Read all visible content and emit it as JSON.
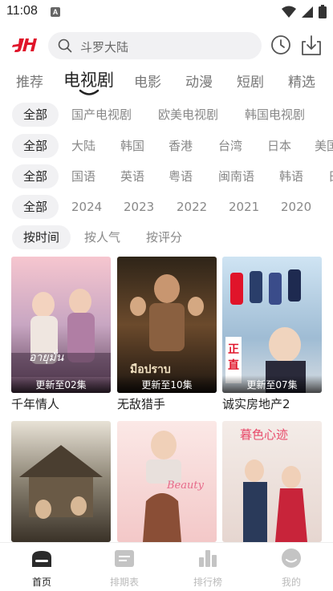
{
  "status": {
    "time": "11:08",
    "notif": "A"
  },
  "search": {
    "placeholder": "斗罗大陆"
  },
  "category_tabs": [
    {
      "label": "推荐"
    },
    {
      "label": "电视剧"
    },
    {
      "label": "电影"
    },
    {
      "label": "动漫"
    },
    {
      "label": "短剧"
    },
    {
      "label": "精选"
    }
  ],
  "filters": {
    "genre": [
      "全部",
      "国产电视剧",
      "欧美电视剧",
      "韩国电视剧"
    ],
    "region": [
      "全部",
      "大陆",
      "韩国",
      "香港",
      "台湾",
      "日本",
      "美国"
    ],
    "language": [
      "全部",
      "国语",
      "英语",
      "粤语",
      "闽南语",
      "韩语",
      "日"
    ],
    "year": [
      "全部",
      "2024",
      "2023",
      "2022",
      "2021",
      "2020"
    ],
    "sort": [
      "按时间",
      "按人气",
      "按评分"
    ]
  },
  "shows": [
    {
      "title": "千年情人",
      "badge": "更新至02集"
    },
    {
      "title": "无敌猎手",
      "badge": "更新至10集"
    },
    {
      "title": "诚实房地产2",
      "badge": "更新至07集"
    },
    {
      "title": "",
      "badge": ""
    },
    {
      "title": "",
      "badge": ""
    },
    {
      "title": "",
      "badge": ""
    }
  ],
  "nav": [
    {
      "label": "首页",
      "icon": "home-icon"
    },
    {
      "label": "排期表",
      "icon": "schedule-icon"
    },
    {
      "label": "排行榜",
      "icon": "ranking-icon"
    },
    {
      "label": "我的",
      "icon": "profile-icon"
    }
  ],
  "colors": {
    "accent": "#e0142a",
    "text": "#222222",
    "muted": "#888888",
    "chip_bg": "#f1f1f3"
  }
}
